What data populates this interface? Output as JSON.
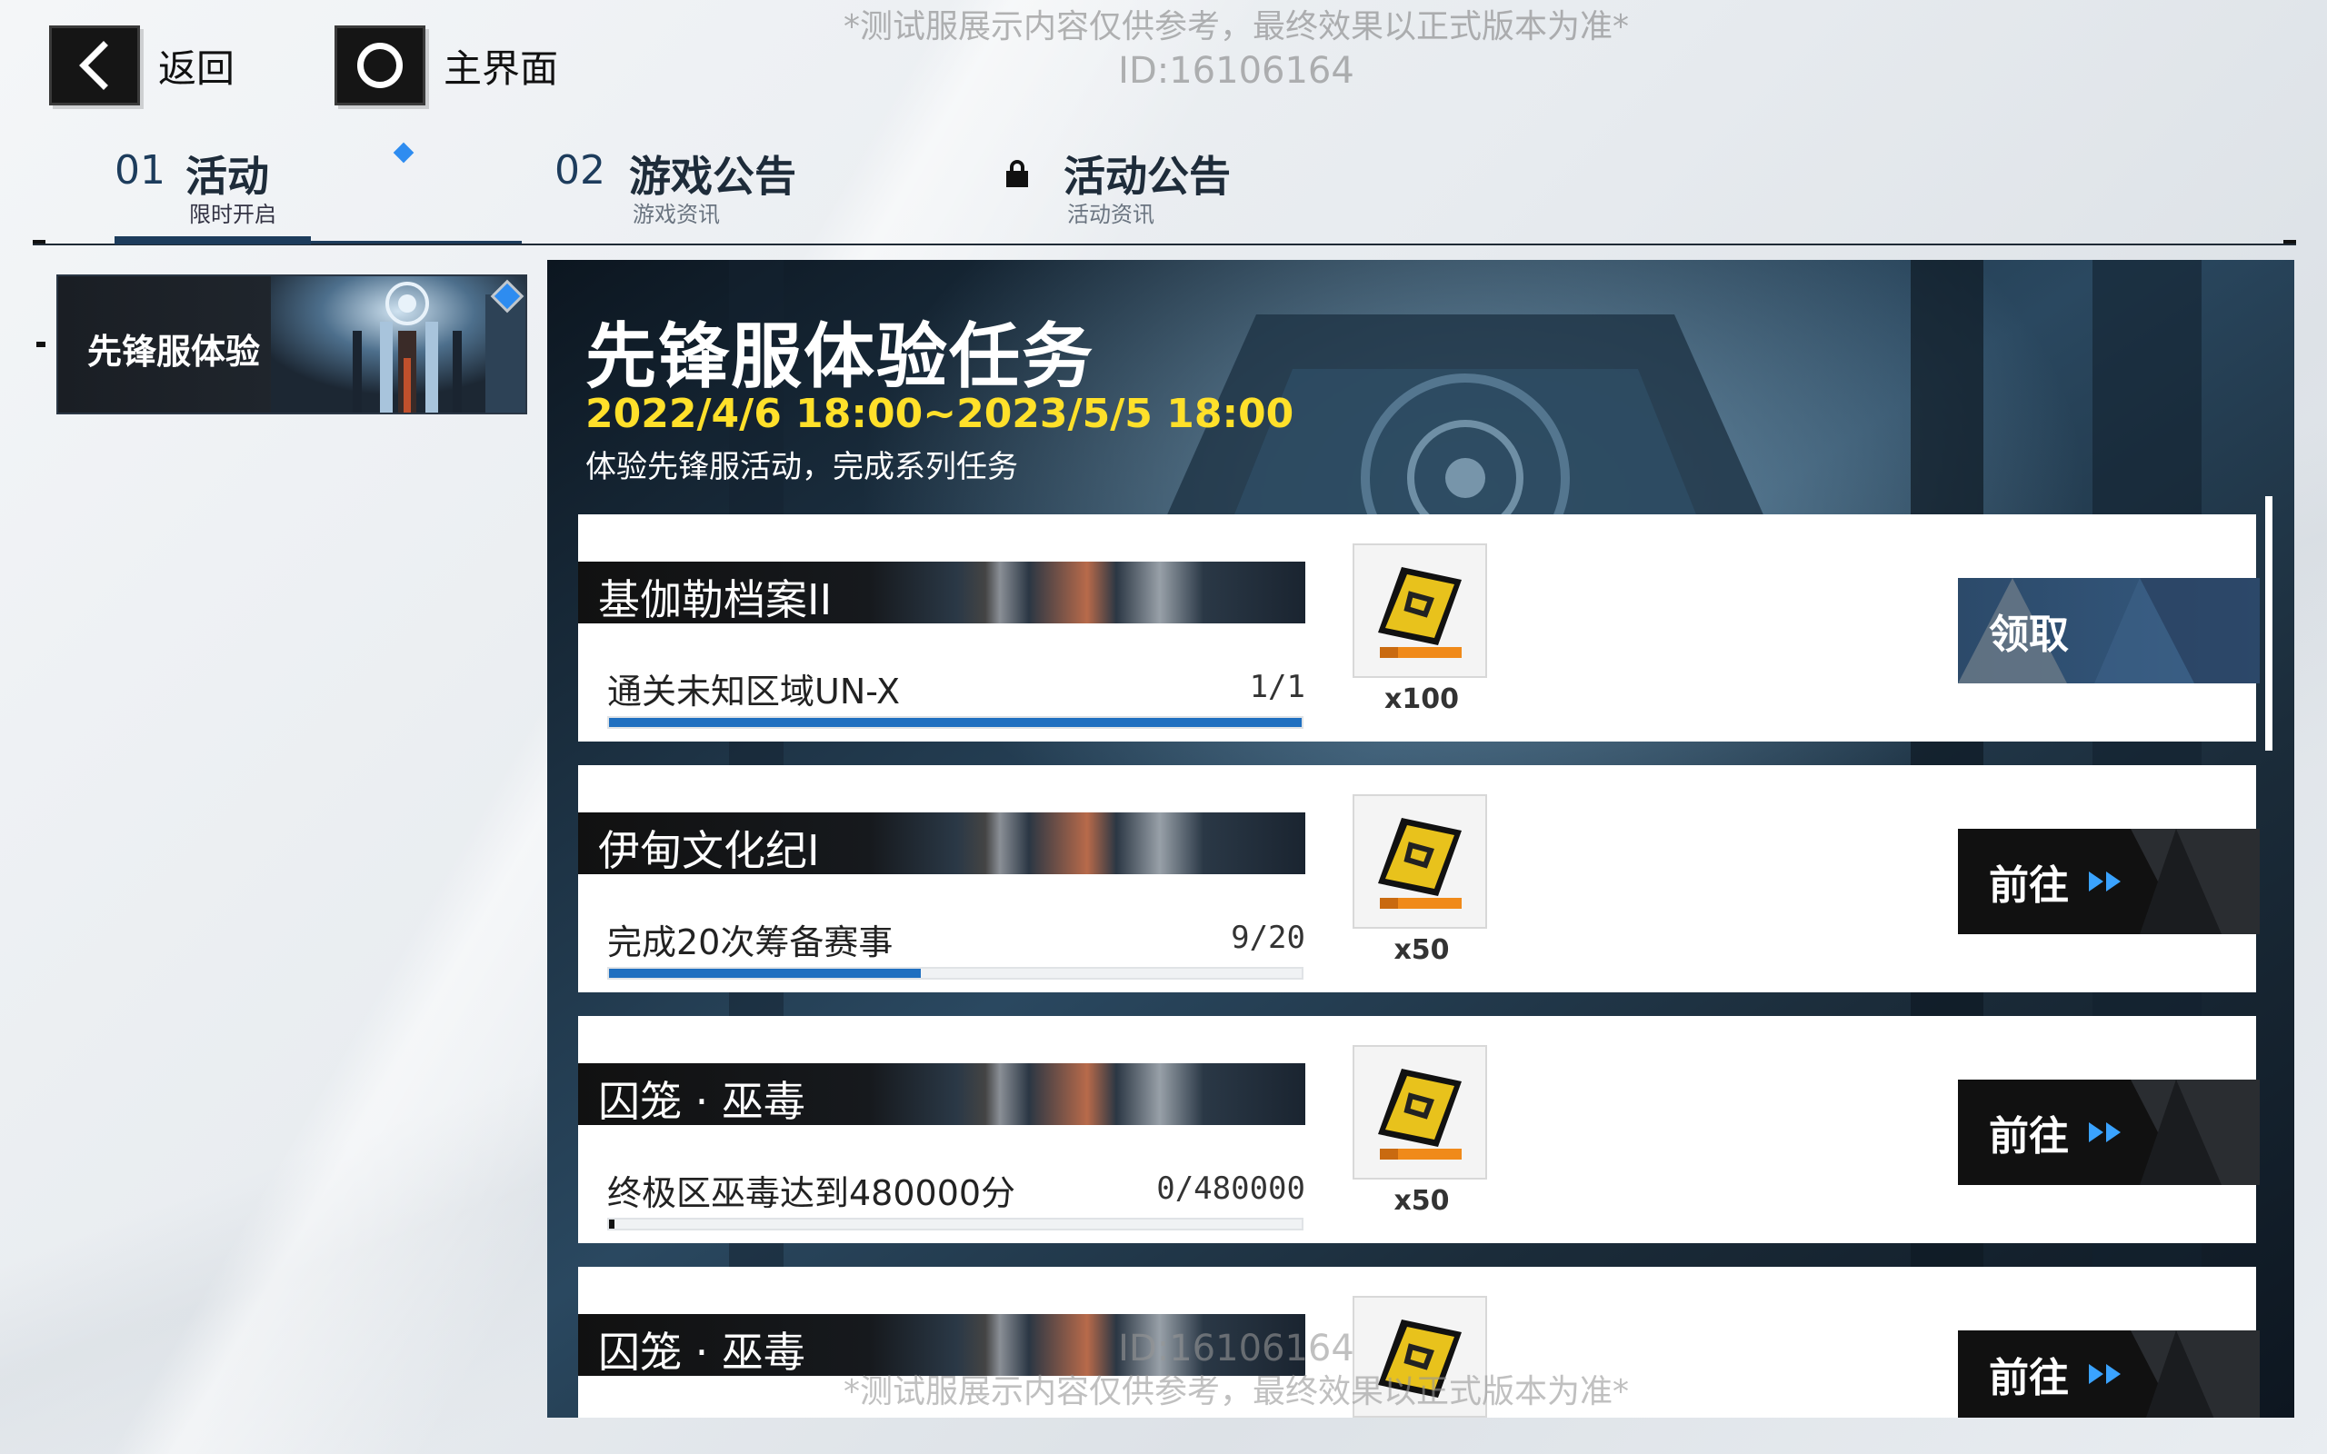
{
  "watermark": {
    "notice": "*测试服展示内容仅供参考，最终效果以正式版本为准*",
    "id": "ID:16106164",
    "id_bottom": "ID:16106164"
  },
  "nav": {
    "back_label": "返回",
    "home_label": "主界面"
  },
  "tabs": [
    {
      "num": "01",
      "name": "活动",
      "sub": "限时开启",
      "active": true
    },
    {
      "num": "02",
      "name": "游戏公告",
      "sub": "游戏资讯",
      "active": false
    },
    {
      "num": "",
      "name": "活动公告",
      "sub": "活动资讯",
      "locked": true
    }
  ],
  "sidebar": {
    "items": [
      {
        "label": "先锋服体验"
      }
    ]
  },
  "event": {
    "title": "先锋服体验任务",
    "period": "2022/4/6 18:00~2023/5/5 18:00",
    "desc": "体验先锋服活动，完成系列任务"
  },
  "tasks": [
    {
      "banner": "基伽勒档案II",
      "task": "通关未知区域UN-X",
      "progress": "1/1",
      "fraction": 1.0,
      "reward_qty": "x100",
      "action": "领取",
      "action_type": "claim"
    },
    {
      "banner": "伊甸文化纪I",
      "task": "完成20次筹备赛事",
      "progress": "9/20",
      "fraction": 0.45,
      "reward_qty": "x50",
      "action": "前往",
      "action_type": "go"
    },
    {
      "banner": "囚笼 · 巫毒",
      "task": "终极区巫毒达到480000分",
      "progress": "0/480000",
      "fraction": 0.0,
      "reward_qty": "x50",
      "action": "前往",
      "action_type": "go"
    },
    {
      "banner": "囚笼 · 巫毒",
      "task": "",
      "progress": "",
      "fraction": 0.0,
      "reward_qty": "",
      "action": "前往",
      "action_type": "go"
    }
  ],
  "colors": {
    "accent_blue": "#1f6fc0",
    "date_yellow": "#ffe02a",
    "arrow_blue": "#3aa3ff"
  }
}
